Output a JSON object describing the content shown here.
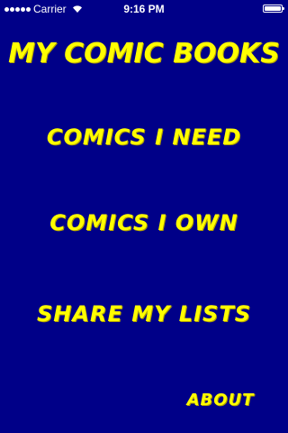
{
  "status_bar": {
    "carrier": "Carrier",
    "time": "9:16 PM"
  },
  "app": {
    "title": "My Comic Books"
  },
  "menu": {
    "comics_i_need": "Comics I Need",
    "comics_i_own": "Comics I Own",
    "share_my_lists": "Share My Lists"
  },
  "about": {
    "label": "About"
  },
  "colors": {
    "background": "#000088",
    "text": "#ffff00"
  }
}
